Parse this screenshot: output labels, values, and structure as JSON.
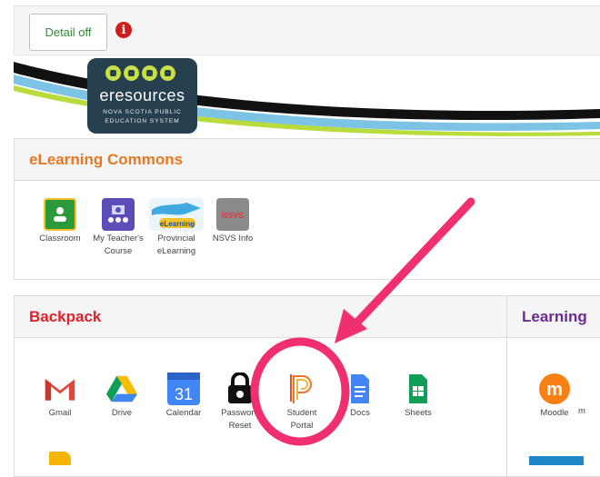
{
  "toolbar": {
    "detail_label": "Detail off",
    "info_glyph": "i"
  },
  "logo": {
    "brand": "eresources",
    "sub1": "NOVA SCOTIA PUBLIC",
    "sub2": "EDUCATION SYSTEM"
  },
  "elearning": {
    "title": "eLearning Commons",
    "title_color": "#e87722",
    "apps": [
      {
        "line1": "Classroom",
        "line2": ""
      },
      {
        "line1": "My Teacher's",
        "line2": "Course"
      },
      {
        "line1": "Provincial",
        "line2": "eLearning"
      },
      {
        "line1": "NSVS Info",
        "line2": ""
      }
    ]
  },
  "backpack": {
    "title": "Backpack",
    "title_color": "#e0202a",
    "apps": [
      {
        "line1": "Gmail",
        "line2": ""
      },
      {
        "line1": "Drive",
        "line2": ""
      },
      {
        "line1": "Calendar",
        "line2": ""
      },
      {
        "line1": "Password",
        "line2": "Reset"
      },
      {
        "line1": "Student",
        "line2": "Portal"
      },
      {
        "line1": "Docs",
        "line2": ""
      },
      {
        "line1": "Sheets",
        "line2": ""
      }
    ],
    "calendar_day": "31",
    "elearning_tile_text": "eLearning",
    "nsvs_tile_text": "NSVS"
  },
  "learning": {
    "title": "Learning",
    "title_color": "#6b2c91",
    "apps": [
      {
        "line1": "Moodle",
        "line2": ""
      },
      {
        "line1": "m",
        "line2": ""
      }
    ]
  },
  "annotation": {
    "color": "#f0306e"
  }
}
